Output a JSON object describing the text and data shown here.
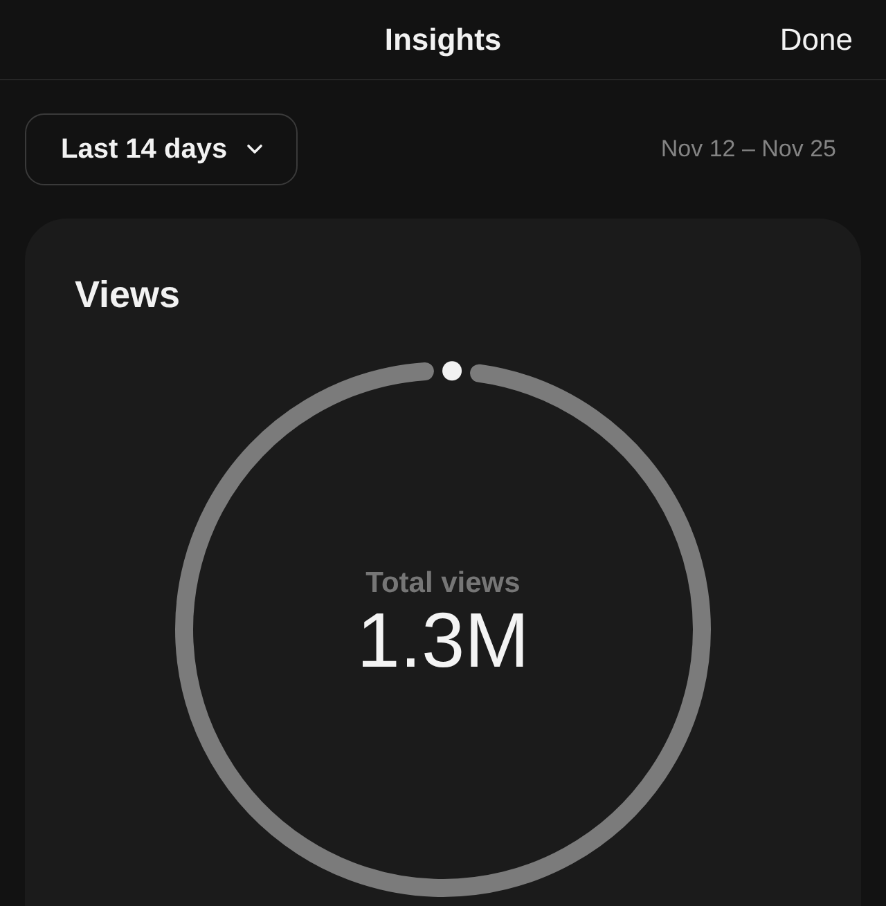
{
  "header": {
    "title": "Insights",
    "done_button": "Done"
  },
  "filter": {
    "range_button": "Last 14 days",
    "date_range": "Nov 12 – Nov 25"
  },
  "views_card": {
    "title": "Views",
    "total_label": "Total views",
    "total_value": "1.3M"
  }
}
